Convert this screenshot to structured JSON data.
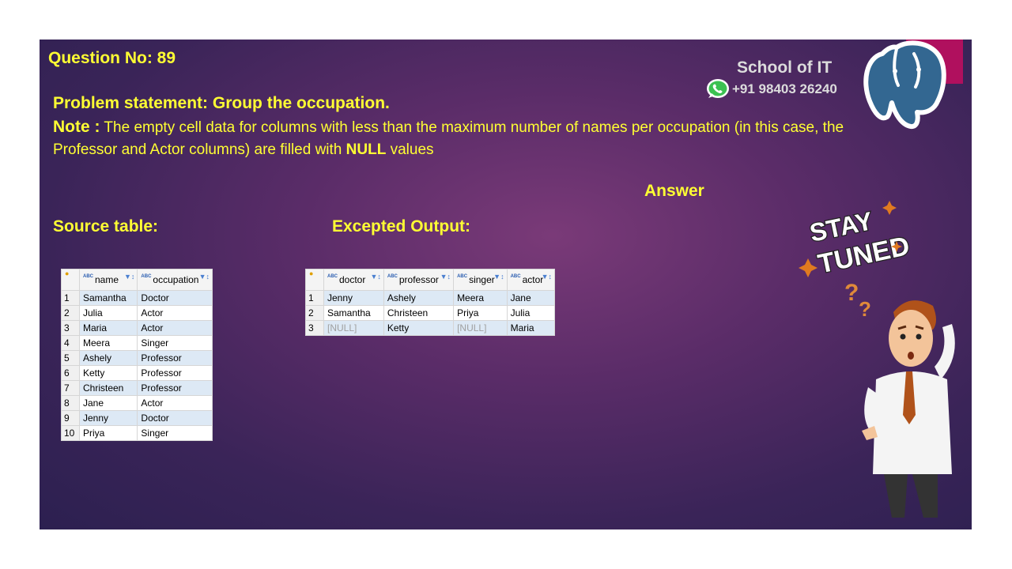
{
  "question_no": "Question No: 89",
  "problem": "Problem statement: Group the occupation.",
  "note": {
    "label": "Note :",
    "text1": " The empty cell data for columns with less than the maximum number of names per occupation (in this case, the Professor and Actor columns) are filled with ",
    "bold": "NULL",
    "text2": " values"
  },
  "answer_label": "Answer",
  "source_label": "Source table:",
  "output_label": "Excepted Output:",
  "branding": {
    "school": "School of IT",
    "phone": "+91 98403 26240"
  },
  "sticker_lines": [
    "STAY",
    "TUNED"
  ],
  "source_table": {
    "headers": [
      "name",
      "occupation"
    ],
    "rows": [
      [
        "1",
        "Samantha",
        "Doctor"
      ],
      [
        "2",
        "Julia",
        "Actor"
      ],
      [
        "3",
        "Maria",
        "Actor"
      ],
      [
        "4",
        "Meera",
        "Singer"
      ],
      [
        "5",
        "Ashely",
        "Professor"
      ],
      [
        "6",
        "Ketty",
        "Professor"
      ],
      [
        "7",
        "Christeen",
        "Professor"
      ],
      [
        "8",
        "Jane",
        "Actor"
      ],
      [
        "9",
        "Jenny",
        "Doctor"
      ],
      [
        "10",
        "Priya",
        "Singer"
      ]
    ]
  },
  "output_table": {
    "headers": [
      "doctor",
      "professor",
      "singer",
      "actor"
    ],
    "rows": [
      [
        "1",
        "Jenny",
        "Ashely",
        "Meera",
        "Jane"
      ],
      [
        "2",
        "Samantha",
        "Christeen",
        "Priya",
        "Julia"
      ],
      [
        "3",
        "[NULL]",
        "Ketty",
        "[NULL]",
        "Maria"
      ]
    ]
  },
  "colors": {
    "accent_yellow": "#ffff33",
    "brand_pink": "#b0105e",
    "slide_bg": "#4a2860"
  }
}
